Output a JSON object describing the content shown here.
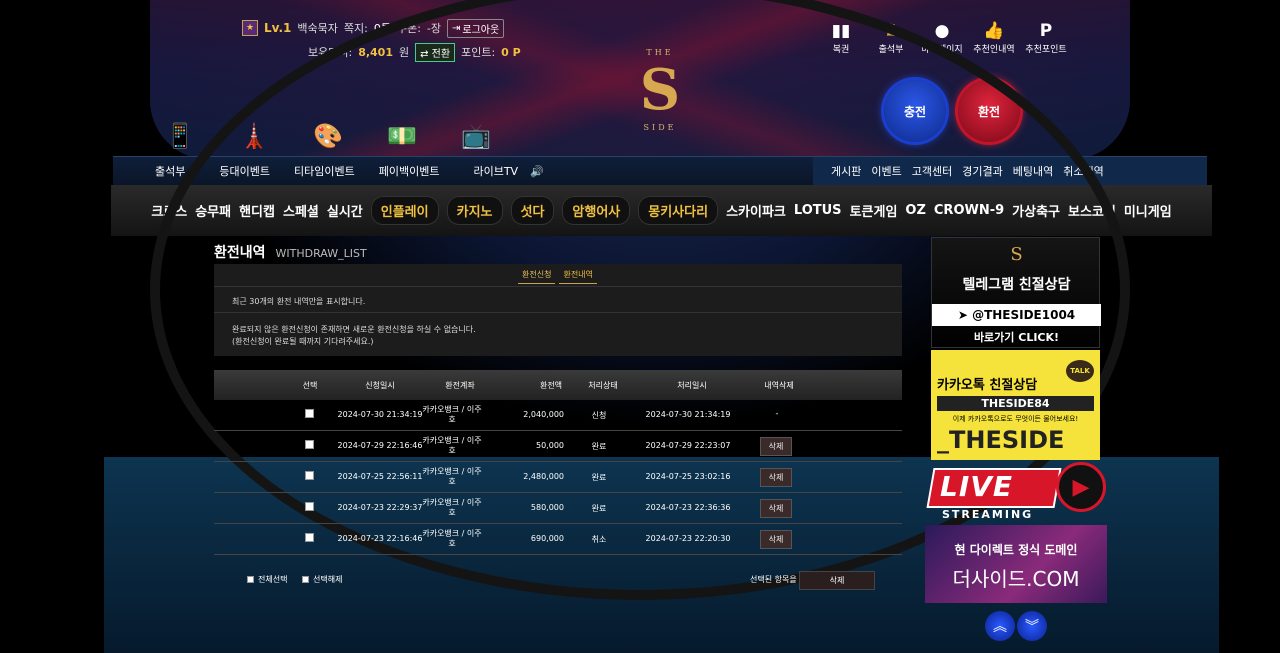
{
  "user": {
    "level": "Lv.1",
    "name": "백숙묵자",
    "note_label": "쪽지:",
    "note_count": "0통",
    "coupon_label": "쿠폰:",
    "coupon_value": "-장",
    "logout": "로그아웃",
    "money_label": "보유머니:",
    "money": "8,401",
    "money_unit": "원",
    "convert": "⇄ 전환",
    "point_label": "포인트:",
    "point": "0 P"
  },
  "logo": {
    "top": "THE",
    "mark": "S",
    "bottom": "SIDE"
  },
  "topnav": [
    {
      "icon": "▮▮",
      "label": "복권"
    },
    {
      "icon": "♛",
      "label": "출석부"
    },
    {
      "icon": "●",
      "label": "마이페이지"
    },
    {
      "icon": "👍",
      "label": "추천인내역"
    },
    {
      "icon": "P",
      "label": "추천포인트"
    }
  ],
  "circle_buttons": {
    "deposit": "충전",
    "withdraw": "환전"
  },
  "feature_icons": [
    "📱",
    "🗼",
    "🎨",
    "💵",
    "📺"
  ],
  "menu1_left": [
    "출석부",
    "등대이벤트",
    "티타임이벤트",
    "페이백이벤트",
    "라이브TV"
  ],
  "sound_icon": "🔊",
  "menu1_right": [
    "게시판",
    "이벤트",
    "고객센터",
    "경기결과",
    "베팅내역",
    "취소내역"
  ],
  "menu2": [
    {
      "label": "크로스",
      "hi": false
    },
    {
      "label": "승무패",
      "hi": false
    },
    {
      "label": "핸디캡",
      "hi": false
    },
    {
      "label": "스페셜",
      "hi": false
    },
    {
      "label": "실시간",
      "hi": false
    },
    {
      "label": "인플레이",
      "hi": true
    },
    {
      "label": "카지노",
      "hi": true
    },
    {
      "label": "섯다",
      "hi": true
    },
    {
      "label": "암행어사",
      "hi": true
    },
    {
      "label": "몽키사다리",
      "hi": true
    },
    {
      "label": "스카이파크",
      "hi": false
    },
    {
      "label": "LOTUS",
      "hi": false
    },
    {
      "label": "토큰게임",
      "hi": false
    },
    {
      "label": "OZ",
      "hi": false
    },
    {
      "label": "CROWN-9",
      "hi": false
    },
    {
      "label": "가상축구",
      "hi": false
    },
    {
      "label": "보스코어",
      "hi": false
    },
    {
      "label": "미니게임",
      "hi": false
    }
  ],
  "page": {
    "title": "환전내역",
    "subtitle": "WITHDRAW_LIST",
    "tab1": "환전신청",
    "tab2": "환전내역",
    "note1": "최근 30개의 환전 내역만을 표시합니다.",
    "note2": "완료되지 않은 환전신청이 존재하면 새로운 환전신청을 하실 수 없습니다.",
    "note3": "(환전신청이 완료될 때까지 기다려주세요.)"
  },
  "table": {
    "headers": [
      "선택",
      "신청일시",
      "환전계좌",
      "환전액",
      "처리상태",
      "처리일시",
      "내역삭제"
    ],
    "rows": [
      {
        "date": "2024-07-30 21:34:19",
        "account": "카카오뱅크 / 이주호",
        "amount": "2,040,000",
        "status": "신청",
        "done": "2024-07-30 21:34:19",
        "del": "-"
      },
      {
        "date": "2024-07-29 22:16:46",
        "account": "카카오뱅크 / 이주호",
        "amount": "50,000",
        "status": "완료",
        "done": "2024-07-29 22:23:07",
        "del": "삭제"
      },
      {
        "date": "2024-07-25 22:56:11",
        "account": "카카오뱅크 / 이주호",
        "amount": "2,480,000",
        "status": "완료",
        "done": "2024-07-25 23:02:16",
        "del": "삭제"
      },
      {
        "date": "2024-07-23 22:29:37",
        "account": "카카오뱅크 / 이주호",
        "amount": "580,000",
        "status": "완료",
        "done": "2024-07-23 22:36:36",
        "del": "삭제"
      },
      {
        "date": "2024-07-23 22:16:46",
        "account": "카카오뱅크 / 이주호",
        "amount": "690,000",
        "status": "취소",
        "done": "2024-07-23 22:20:30",
        "del": "삭제"
      }
    ]
  },
  "footer": {
    "select_all": "전체선택",
    "deselect": "선택해제",
    "selected": "선택된 항목을",
    "delete": "삭제"
  },
  "ads": {
    "telegram_title": "텔레그램 친절상담",
    "telegram_id": "@THESIDE1004",
    "telegram_go": "바로가기 CLICK!",
    "kakao_talk": "TALK",
    "kakao_title": "카카오톡 친절상담",
    "kakao_id": "THESIDE84",
    "kakao_desc": "이제 카카오톡으로도 무엇이든 물어보세요!",
    "kakao_brand": "_THESIDE",
    "live": "LIVE",
    "streaming": "STREAMING",
    "domain_title": "현 다이렉트 정식 도메인",
    "domain": "더사이드.COM"
  },
  "arrows": [
    "︽",
    "︾"
  ]
}
